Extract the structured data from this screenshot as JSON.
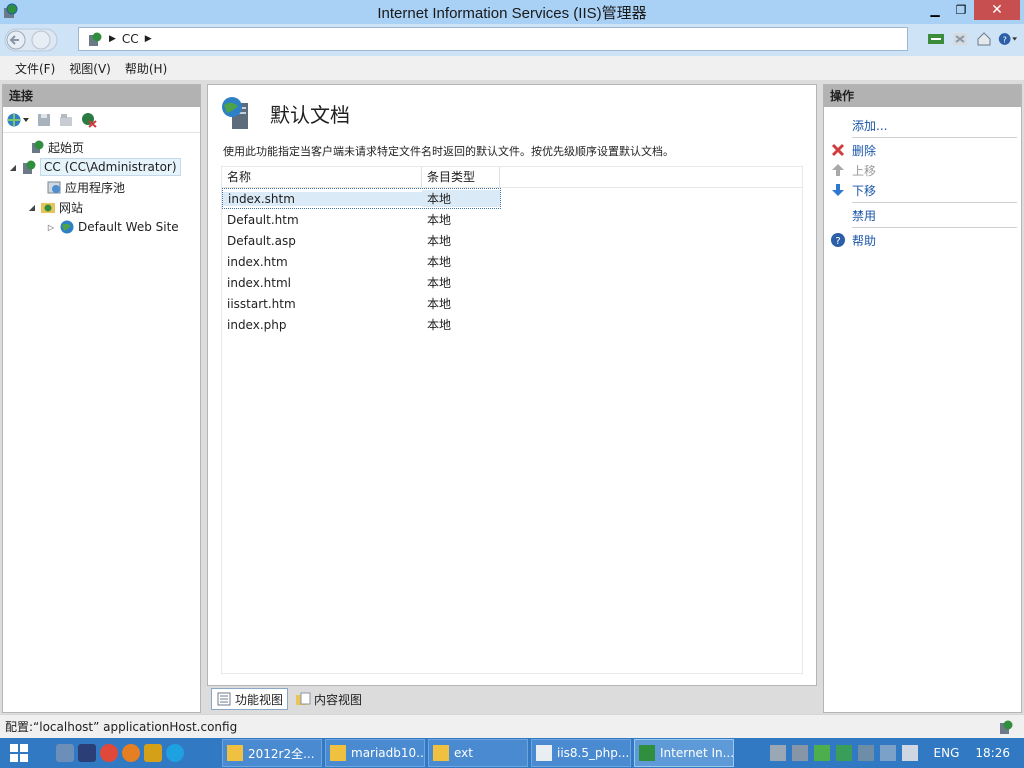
{
  "window": {
    "title": "Internet Information Services (IIS)管理器"
  },
  "address": {
    "crumbs": [
      "CC"
    ]
  },
  "menu": {
    "items": [
      "文件(F)",
      "视图(V)",
      "帮助(H)"
    ]
  },
  "connections": {
    "header": "连接",
    "tree": [
      {
        "label": "起始页",
        "level": 0,
        "toggle": ""
      },
      {
        "label": "CC (CC\\Administrator)",
        "level": 0,
        "toggle": "◢",
        "selected": true
      },
      {
        "label": "应用程序池",
        "level": 1,
        "toggle": ""
      },
      {
        "label": "网站",
        "level": 1,
        "toggle": "◢"
      },
      {
        "label": "Default Web Site",
        "level": 2,
        "toggle": "▷"
      }
    ]
  },
  "feature": {
    "title": "默认文档",
    "description": "使用此功能指定当客户端未请求特定文件名时返回的默认文件。按优先级顺序设置默认文档。",
    "columns": [
      "名称",
      "条目类型"
    ],
    "rows": [
      {
        "name": "index.shtm",
        "type": "本地",
        "selected": true
      },
      {
        "name": "Default.htm",
        "type": "本地"
      },
      {
        "name": "Default.asp",
        "type": "本地"
      },
      {
        "name": "index.htm",
        "type": "本地"
      },
      {
        "name": "index.html",
        "type": "本地"
      },
      {
        "name": "iisstart.htm",
        "type": "本地"
      },
      {
        "name": "index.php",
        "type": "本地"
      }
    ]
  },
  "views": {
    "feature_view": "功能视图",
    "content_view": "内容视图"
  },
  "actions": {
    "header": "操作",
    "add": "添加...",
    "delete": "删除",
    "move_up": "上移",
    "move_down": "下移",
    "disable": "禁用",
    "help": "帮助"
  },
  "status": {
    "text": "配置:“localhost” applicationHost.config"
  },
  "taskbar": {
    "tasks": [
      "2012r2全...",
      "mariadb10...",
      "ext",
      "iis8.5_php...",
      "Internet In..."
    ],
    "lang": "ENG",
    "time": "18:26"
  }
}
